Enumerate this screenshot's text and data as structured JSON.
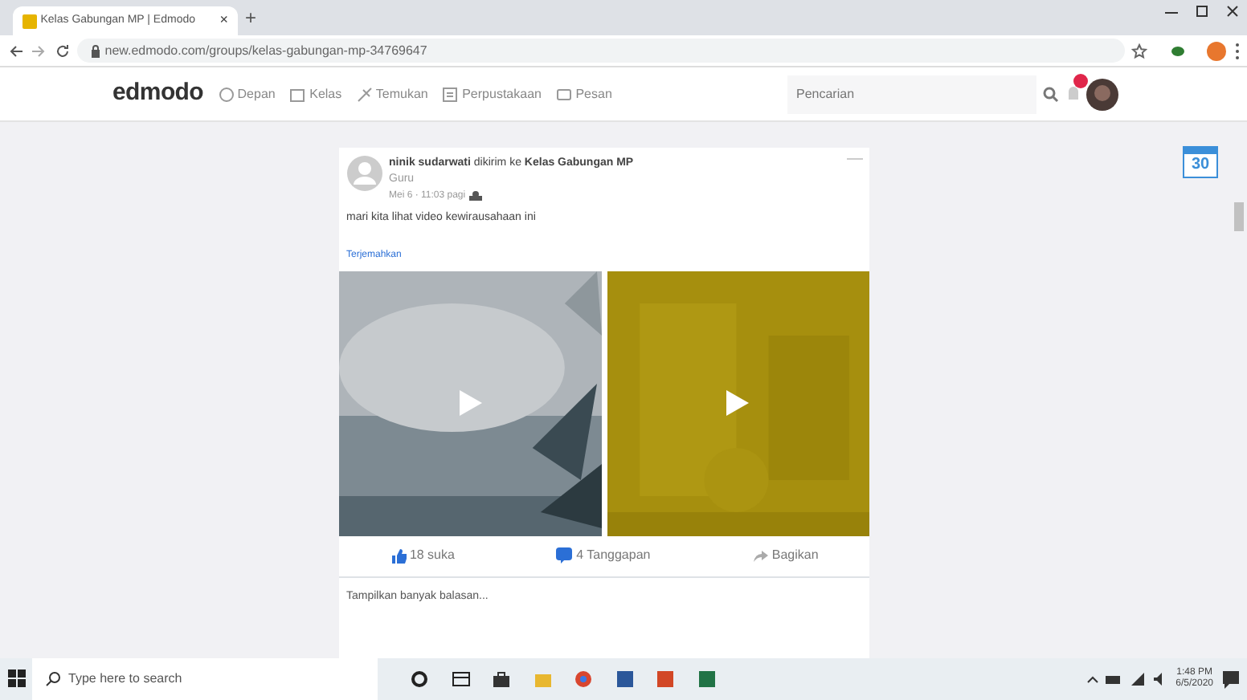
{
  "browser": {
    "tab_title": "Kelas Gabungan MP | Edmodo",
    "tab_close": "×",
    "new_tab": "+",
    "url": "new.edmodo.com/groups/kelas-gabungan-mp-34769647"
  },
  "nav": {
    "brand": "edmodo",
    "items": [
      {
        "label": "Depan"
      },
      {
        "label": "Kelas"
      },
      {
        "label": "Temukan"
      },
      {
        "label": "Perpustakaan"
      },
      {
        "label": "Pesan"
      }
    ],
    "search_placeholder": "Pencarian"
  },
  "post": {
    "author": "ninik sudarwati",
    "verb": "dikirim ke",
    "group": "Kelas Gabungan MP",
    "role": "Guru",
    "time": "Mei 6 · 11:03 pagi",
    "text": "mari kita lihat video kewirausahaan ini",
    "translate": "Terjemahkan",
    "actions": [
      {
        "kind": "like",
        "label": "18 suka"
      },
      {
        "kind": "comment",
        "label": "4 Tanggapan"
      },
      {
        "kind": "share",
        "label": "Bagikan"
      }
    ],
    "more_replies": "Tampilkan banyak balasan..."
  },
  "calendar": {
    "day": "30"
  },
  "taskbar": {
    "search_placeholder": "Type here to search",
    "time": "1:48 PM",
    "date": "6/5/2020"
  }
}
